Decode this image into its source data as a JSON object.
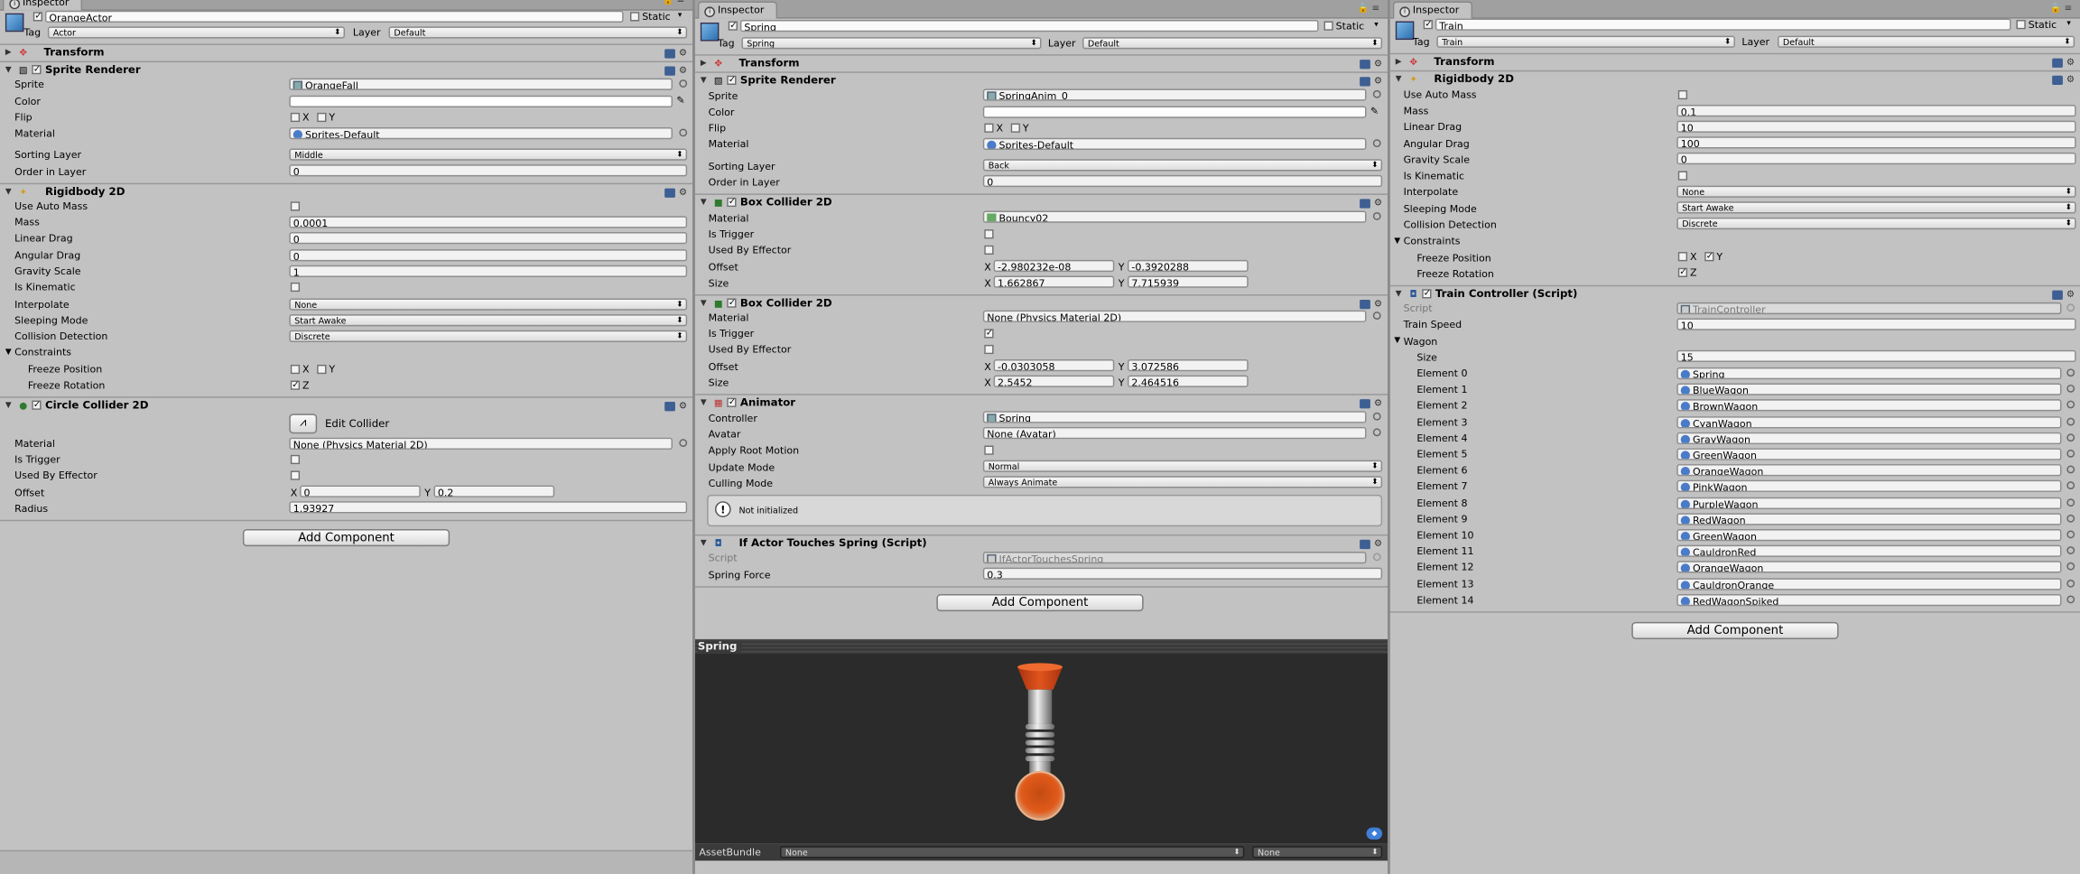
{
  "left": {
    "tab": "Inspector",
    "object_name": "OrangeActor",
    "static_label": "Static",
    "tag_label": "Tag",
    "tag_value": "Actor",
    "layer_label": "Layer",
    "layer_value": "Default",
    "transform_title": "Transform",
    "sprite_renderer": {
      "title": "Sprite Renderer",
      "sprite_label": "Sprite",
      "sprite_value": "OrangeFall",
      "color_label": "Color",
      "flip_label": "Flip",
      "flip_x": "X",
      "flip_y": "Y",
      "material_label": "Material",
      "material_value": "Sprites-Default",
      "sorting_layer_label": "Sorting Layer",
      "sorting_layer_value": "Middle",
      "order_label": "Order in Layer",
      "order_value": "0"
    },
    "rigidbody": {
      "title": "Rigidbody 2D",
      "use_auto_mass": "Use Auto Mass",
      "mass_label": "Mass",
      "mass": "0.0001",
      "linear_drag_label": "Linear Drag",
      "linear_drag": "0",
      "angular_drag_label": "Angular Drag",
      "angular_drag": "0",
      "gravity_label": "Gravity Scale",
      "gravity": "1",
      "kinematic_label": "Is Kinematic",
      "interpolate_label": "Interpolate",
      "interpolate": "None",
      "sleeping_label": "Sleeping Mode",
      "sleeping": "Start Awake",
      "collision_label": "Collision Detection",
      "collision": "Discrete",
      "constraints_label": "Constraints",
      "freeze_pos_label": "Freeze Position",
      "freeze_rot_label": "Freeze Rotation",
      "x": "X",
      "y": "Y",
      "z": "Z"
    },
    "circle_collider": {
      "title": "Circle Collider 2D",
      "edit_collider": "Edit Collider",
      "material_label": "Material",
      "material_value": "None (Physics Material 2D)",
      "trigger_label": "Is Trigger",
      "effector_label": "Used By Effector",
      "offset_label": "Offset",
      "offset_x_label": "X",
      "offset_x": "0",
      "offset_y_label": "Y",
      "offset_y": "0.2",
      "radius_label": "Radius",
      "radius": "1.93927"
    },
    "add_component": "Add Component"
  },
  "middle": {
    "tab": "Inspector",
    "object_name": "Spring",
    "static_label": "Static",
    "tag_label": "Tag",
    "tag_value": "Spring",
    "layer_label": "Layer",
    "layer_value": "Default",
    "transform_title": "Transform",
    "sprite_renderer": {
      "title": "Sprite Renderer",
      "sprite_label": "Sprite",
      "sprite_value": "SpringAnim_0",
      "color_label": "Color",
      "flip_label": "Flip",
      "flip_x": "X",
      "flip_y": "Y",
      "material_label": "Material",
      "material_value": "Sprites-Default",
      "sorting_layer_label": "Sorting Layer",
      "sorting_layer_value": "Back",
      "order_label": "Order in Layer",
      "order_value": "0"
    },
    "box1": {
      "title": "Box Collider 2D",
      "material_label": "Material",
      "material_value": "Bouncy02",
      "trigger_label": "Is Trigger",
      "effector_label": "Used By Effector",
      "offset_label": "Offset",
      "offset_x": "-2.980232e-08",
      "offset_y": "-0.3920288",
      "size_label": "Size",
      "size_x": "1.662867",
      "size_y": "7.715939",
      "x": "X",
      "y": "Y"
    },
    "box2": {
      "title": "Box Collider 2D",
      "material_label": "Material",
      "material_value": "None (Physics Material 2D)",
      "trigger_label": "Is Trigger",
      "effector_label": "Used By Effector",
      "offset_label": "Offset",
      "offset_x": "-0.0303058",
      "offset_y": "3.072586",
      "size_label": "Size",
      "size_x": "2.5452",
      "size_y": "2.464516",
      "x": "X",
      "y": "Y"
    },
    "animator": {
      "title": "Animator",
      "controller_label": "Controller",
      "controller": "Spring",
      "avatar_label": "Avatar",
      "avatar": "None (Avatar)",
      "root_motion_label": "Apply Root Motion",
      "update_mode_label": "Update Mode",
      "update_mode": "Normal",
      "culling_label": "Culling Mode",
      "culling": "Always Animate",
      "warning": "Not initialized"
    },
    "script": {
      "title": "If Actor Touches Spring (Script)",
      "script_label": "Script",
      "script_value": "IfActorTouchesSpring",
      "force_label": "Spring Force",
      "force": "0.3"
    },
    "add_component": "Add Component",
    "preview": {
      "title": "Spring",
      "assetbundle_label": "AssetBundle",
      "assetbundle": "None",
      "variant": "None"
    }
  },
  "right": {
    "tab": "Inspector",
    "object_name": "Train",
    "static_label": "Static",
    "tag_label": "Tag",
    "tag_value": "Train",
    "layer_label": "Layer",
    "layer_value": "Default",
    "transform_title": "Transform",
    "rigidbody": {
      "title": "Rigidbody 2D",
      "use_auto_mass": "Use Auto Mass",
      "mass_label": "Mass",
      "mass": "0.1",
      "linear_drag_label": "Linear Drag",
      "linear_drag": "10",
      "angular_drag_label": "Angular Drag",
      "angular_drag": "100",
      "gravity_label": "Gravity Scale",
      "gravity": "0",
      "kinematic_label": "Is Kinematic",
      "interpolate_label": "Interpolate",
      "interpolate": "None",
      "sleeping_label": "Sleeping Mode",
      "sleeping": "Start Awake",
      "collision_label": "Collision Detection",
      "collision": "Discrete",
      "constraints_label": "Constraints",
      "freeze_pos_label": "Freeze Position",
      "freeze_rot_label": "Freeze Rotation",
      "x": "X",
      "y": "Y",
      "z": "Z"
    },
    "train": {
      "title": "Train Controller (Script)",
      "script_label": "Script",
      "script_value": "TrainController",
      "speed_label": "Train Speed",
      "speed": "10",
      "wagon_label": "Wagon",
      "size_label": "Size",
      "size": "15",
      "elements": [
        {
          "label": "Element 0",
          "value": "Spring"
        },
        {
          "label": "Element 1",
          "value": "BlueWagon"
        },
        {
          "label": "Element 2",
          "value": "BrownWagon"
        },
        {
          "label": "Element 3",
          "value": "CyanWagon"
        },
        {
          "label": "Element 4",
          "value": "GrayWagon"
        },
        {
          "label": "Element 5",
          "value": "GreenWagon"
        },
        {
          "label": "Element 6",
          "value": "OrangeWagon"
        },
        {
          "label": "Element 7",
          "value": "PinkWagon"
        },
        {
          "label": "Element 8",
          "value": "PurpleWagon"
        },
        {
          "label": "Element 9",
          "value": "RedWagon"
        },
        {
          "label": "Element 10",
          "value": "GreenWagon"
        },
        {
          "label": "Element 11",
          "value": "CauldronRed"
        },
        {
          "label": "Element 12",
          "value": "OrangeWagon"
        },
        {
          "label": "Element 13",
          "value": "CauldronOrange"
        },
        {
          "label": "Element 14",
          "value": "RedWagonSpiked"
        }
      ]
    },
    "add_component": "Add Component"
  }
}
